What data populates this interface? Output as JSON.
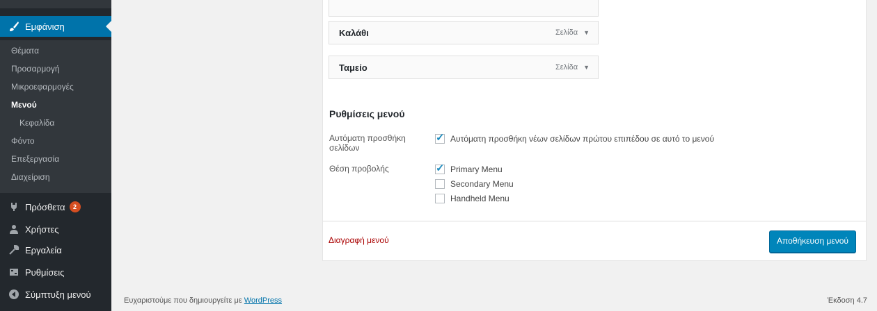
{
  "sidebar": {
    "active": {
      "label": "Εμφάνιση",
      "icon": "paintbrush-icon"
    },
    "submenu": [
      {
        "label": "Θέματα"
      },
      {
        "label": "Προσαρμογή"
      },
      {
        "label": "Μικροεφαρμογές"
      },
      {
        "label": "Μενού",
        "current": true
      },
      {
        "label": "Κεφαλίδα"
      },
      {
        "label": "Φόντο"
      },
      {
        "label": "Επεξεργασία"
      },
      {
        "label": "Διαχείριση"
      }
    ],
    "items": [
      {
        "label": "Πρόσθετα",
        "icon": "plugin-icon",
        "badge": "2"
      },
      {
        "label": "Χρήστες",
        "icon": "users-icon"
      },
      {
        "label": "Εργαλεία",
        "icon": "wrench-icon"
      },
      {
        "label": "Ρυθμίσεις",
        "icon": "settings-icon"
      },
      {
        "label": "Σύμπτυξη μενού",
        "icon": "collapse-icon"
      }
    ]
  },
  "menu_items": [
    {
      "title": "",
      "type": ""
    },
    {
      "title": "Καλάθι",
      "type": "Σελίδα"
    },
    {
      "title": "Ταμείο",
      "type": "Σελίδα"
    }
  ],
  "settings": {
    "heading": "Ρυθμίσεις μενού",
    "auto_add_label": "Αυτόματη προσθήκη σελίδων",
    "auto_add_option": "Αυτόματη προσθήκη νέων σελίδων πρώτου επιπέδου σε αυτό το μενού",
    "auto_add_checked": true,
    "location_label": "Θέση προβολής",
    "locations": [
      {
        "label": "Primary Menu",
        "checked": true
      },
      {
        "label": "Secondary Menu",
        "checked": false
      },
      {
        "label": "Handheld Menu",
        "checked": false
      }
    ]
  },
  "actions": {
    "delete_label": "Διαγραφή μενού",
    "save_label": "Αποθήκευση μενού"
  },
  "footer": {
    "thanks_text": "Ευχαριστούμε που δημιουργείτε με",
    "wp_link": "WordPress",
    "version": "Έκδοση 4.7"
  },
  "colors": {
    "sidebar_bg": "#23282d",
    "active_bg": "#0073aa",
    "button_bg": "#0085ba",
    "delete_red": "#aa0000"
  }
}
